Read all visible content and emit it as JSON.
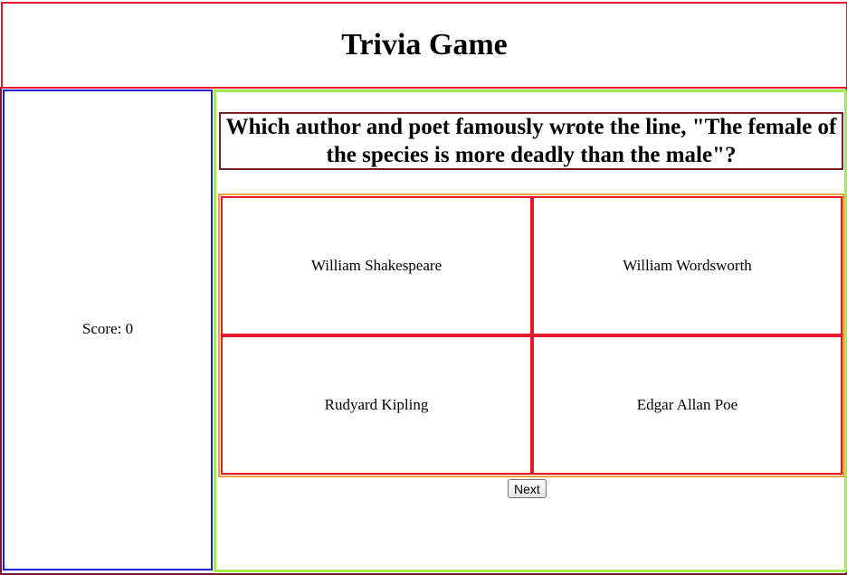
{
  "header": {
    "title": "Trivia Game"
  },
  "sidebar": {
    "score_text": "Score: 0"
  },
  "question": {
    "text": "Which author and poet famously wrote the line, \"The female of the species is more deadly than the male\"?"
  },
  "answers": [
    "William Shakespeare",
    "William Wordsworth",
    "Rudyard Kipling",
    "Edgar Allan Poe"
  ],
  "controls": {
    "next_label": "Next"
  },
  "colors": {
    "header_border": "#e8172c",
    "sidebar_border": "#1f1fd6",
    "main_border": "#a3ef4a",
    "question_border": "#7a1f2a",
    "answers_border": "#f2a23a",
    "answer_border": "#e8172c"
  }
}
